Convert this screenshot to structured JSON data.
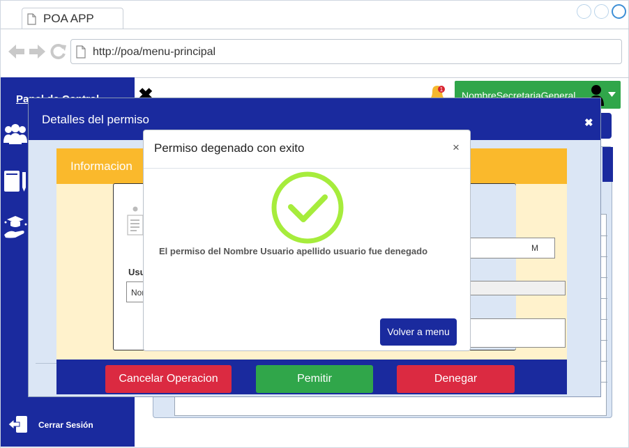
{
  "browser": {
    "tab_title": "POA APP",
    "url": "http://poa/menu-principal"
  },
  "sidebar": {
    "title": "Panel de Control",
    "logout_label": "Cerrar Sesión"
  },
  "header": {
    "close_symbol": "✖",
    "user_name": "NombreSecretariaGeneral",
    "notification_count": "1"
  },
  "details_modal": {
    "title": "Detalles del permiso",
    "close_symbol": "✖",
    "card_title": "Informacion",
    "user_label": "Usuario",
    "name_value": "Nombre",
    "time_value": "M",
    "buttons": {
      "cancel": "Cancelar Operacion",
      "permit": "Pemitir",
      "deny": "Denegar"
    }
  },
  "success_modal": {
    "title": "Permiso degenado con exito",
    "close_symbol": "×",
    "message": "El permiso del Nombre Usuario apellido usuario fue denegado",
    "button": "Volver a menu"
  },
  "colors": {
    "primary": "#1a2a9e",
    "success": "#30a64a",
    "danger": "#db2a41",
    "warning": "#fab92c",
    "check": "#a6ec3c"
  }
}
